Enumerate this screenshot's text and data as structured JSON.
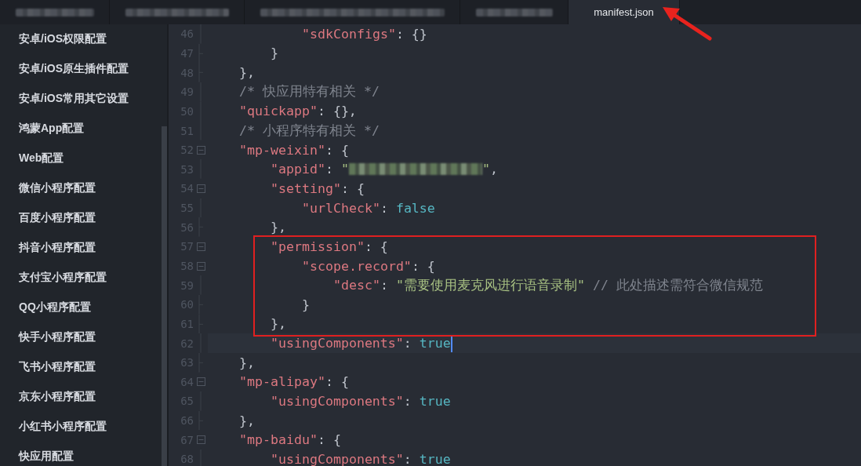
{
  "tabs": [
    {
      "redacted": true,
      "selected": false,
      "pointer": false
    },
    {
      "redacted": true,
      "selected": false,
      "pointer": false
    },
    {
      "redacted": true,
      "selected": false,
      "pointer": false
    },
    {
      "redacted": true,
      "selected": false,
      "pointer": false
    },
    {
      "redacted": false,
      "label": "manifest.json",
      "selected": true,
      "pointer": true
    }
  ],
  "sidebar": {
    "items": [
      "安卓/iOS权限配置",
      "安卓/iOS原生插件配置",
      "安卓/iOS常用其它设置",
      "鸿蒙App配置",
      "Web配置",
      "微信小程序配置",
      "百度小程序配置",
      "抖音小程序配置",
      "支付宝小程序配置",
      "QQ小程序配置",
      "快手小程序配置",
      "飞书小程序配置",
      "京东小程序配置",
      "小红书小程序配置",
      "快应用配置"
    ]
  },
  "editor": {
    "blocks": [
      {
        "children": [
          {
            "children": [
              {
                "line": {
                  "number": "46",
                  "current": false,
                  "tokens": [
                    {
                      "kind": "key",
                      "text": "\"sdkConfigs\""
                    },
                    {
                      "kind": "punct",
                      "text": ": {}"
                    }
                  ]
                }
              }
            ],
            "end": {
              "number": "47",
              "current": false,
              "tokens": [
                {
                  "kind": "punct",
                  "text": "}"
                }
              ]
            }
          }
        ],
        "end": {
          "number": "48",
          "current": false,
          "tokens": [
            {
              "kind": "punct",
              "text": "},"
            }
          ]
        }
      },
      {
        "line": {
          "number": "49",
          "current": false,
          "tokens": [
            {
              "kind": "comment",
              "text": "/* 快应用特有相关 */"
            }
          ]
        }
      },
      {
        "line": {
          "number": "50",
          "current": false,
          "tokens": [
            {
              "kind": "key",
              "text": "\"quickapp\""
            },
            {
              "kind": "punct",
              "text": ": {},"
            }
          ]
        }
      },
      {
        "line": {
          "number": "51",
          "current": false,
          "tokens": [
            {
              "kind": "comment",
              "text": "/* 小程序特有相关 */"
            }
          ]
        }
      },
      {
        "line": {
          "number": "52",
          "current": false,
          "tokens": [
            {
              "kind": "key",
              "text": "\"mp-weixin\""
            },
            {
              "kind": "punct",
              "text": ": {"
            }
          ]
        },
        "children": [
          {
            "line": {
              "number": "53",
              "current": false,
              "tokens": [
                {
                  "kind": "key",
                  "text": "\"appid\""
                },
                {
                  "kind": "punct",
                  "text": ": "
                },
                {
                  "kind": "string",
                  "text": "\""
                },
                {
                  "kind": "redacted"
                },
                {
                  "kind": "string",
                  "text": "\""
                },
                {
                  "kind": "punct",
                  "text": ","
                }
              ]
            }
          },
          {
            "line": {
              "number": "54",
              "current": false,
              "tokens": [
                {
                  "kind": "key",
                  "text": "\"setting\""
                },
                {
                  "kind": "punct",
                  "text": ": {"
                }
              ]
            },
            "children": [
              {
                "line": {
                  "number": "55",
                  "current": false,
                  "tokens": [
                    {
                      "kind": "key",
                      "text": "\"urlCheck\""
                    },
                    {
                      "kind": "punct",
                      "text": ": "
                    },
                    {
                      "kind": "bool",
                      "text": "false"
                    }
                  ]
                }
              }
            ],
            "end": {
              "number": "56",
              "current": false,
              "tokens": [
                {
                  "kind": "punct",
                  "text": "},"
                }
              ]
            }
          },
          {
            "boxed": true,
            "line": {
              "number": "57",
              "current": false,
              "tokens": [
                {
                  "kind": "key",
                  "text": "\"permission\""
                },
                {
                  "kind": "punct",
                  "text": ": {"
                }
              ]
            },
            "children": [
              {
                "line": {
                  "number": "58",
                  "current": false,
                  "tokens": [
                    {
                      "kind": "key",
                      "text": "\"scope.record\""
                    },
                    {
                      "kind": "punct",
                      "text": ": {"
                    }
                  ]
                },
                "children": [
                  {
                    "line": {
                      "number": "59",
                      "current": false,
                      "tokens": [
                        {
                          "kind": "key",
                          "text": "\"desc\""
                        },
                        {
                          "kind": "punct",
                          "text": ": "
                        },
                        {
                          "kind": "string",
                          "text": "\"需要使用麦克风进行语音录制\""
                        },
                        {
                          "kind": "comment",
                          "text": "// 此处描述需符合微信规范"
                        }
                      ]
                    }
                  }
                ],
                "end": {
                  "number": "60",
                  "current": false,
                  "tokens": [
                    {
                      "kind": "punct",
                      "text": "}"
                    }
                  ]
                }
              }
            ],
            "end": {
              "number": "61",
              "current": false,
              "tokens": [
                {
                  "kind": "punct",
                  "text": "},"
                }
              ]
            }
          },
          {
            "line": {
              "number": "62",
              "current": true,
              "tokens": [
                {
                  "kind": "key",
                  "text": "\"usingComponents\""
                },
                {
                  "kind": "punct",
                  "text": ": "
                },
                {
                  "kind": "bool",
                  "text": "true"
                }
              ]
            }
          }
        ],
        "end": {
          "number": "63",
          "current": false,
          "tokens": [
            {
              "kind": "punct",
              "text": "},"
            }
          ]
        }
      },
      {
        "line": {
          "number": "64",
          "current": false,
          "tokens": [
            {
              "kind": "key",
              "text": "\"mp-alipay\""
            },
            {
              "kind": "punct",
              "text": ": {"
            }
          ]
        },
        "children": [
          {
            "line": {
              "number": "65",
              "current": false,
              "tokens": [
                {
                  "kind": "key",
                  "text": "\"usingComponents\""
                },
                {
                  "kind": "punct",
                  "text": ": "
                },
                {
                  "kind": "bool",
                  "text": "true"
                }
              ]
            }
          }
        ],
        "end": {
          "number": "66",
          "current": false,
          "tokens": [
            {
              "kind": "punct",
              "text": "},"
            }
          ]
        }
      },
      {
        "line": {
          "number": "67",
          "current": false,
          "tokens": [
            {
              "kind": "key",
              "text": "\"mp-baidu\""
            },
            {
              "kind": "punct",
              "text": ": {"
            }
          ]
        },
        "children": [
          {
            "line": {
              "number": "68",
              "current": false,
              "tokens": [
                {
                  "kind": "key",
                  "text": "\"usingComponents\""
                },
                {
                  "kind": "punct",
                  "text": ": "
                },
                {
                  "kind": "bool",
                  "text": "true"
                }
              ]
            }
          }
        ]
      }
    ]
  }
}
